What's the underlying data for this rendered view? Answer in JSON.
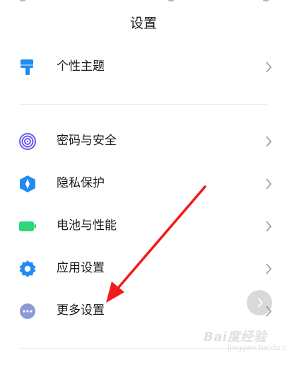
{
  "header": {
    "title": "设置"
  },
  "items": [
    {
      "id": "theme",
      "label": "个性主题",
      "icon": "paint-brush-icon",
      "color": "#1f8cf2"
    },
    {
      "id": "password",
      "label": "密码与安全",
      "icon": "fingerprint-icon",
      "color": "#6b5bf0"
    },
    {
      "id": "privacy",
      "label": "隐私保护",
      "icon": "privacy-shield-icon",
      "color": "#1f8cf2"
    },
    {
      "id": "battery",
      "label": "电池与性能",
      "icon": "battery-icon",
      "color": "#2fd67a"
    },
    {
      "id": "apps",
      "label": "应用设置",
      "icon": "gear-icon",
      "color": "#1f8cf2"
    },
    {
      "id": "more",
      "label": "更多设置",
      "icon": "more-dots-icon",
      "color": "#8c9bd8"
    }
  ],
  "annotation": {
    "icon": "red-arrow-icon",
    "color": "#f21b1b"
  },
  "watermark": {
    "main": "Bai度经验",
    "sub": "jingyan.baidu.com"
  },
  "colors": {
    "text": "#1a1a1a",
    "chevron": "#9a9a9a",
    "divider": "#ececec"
  }
}
